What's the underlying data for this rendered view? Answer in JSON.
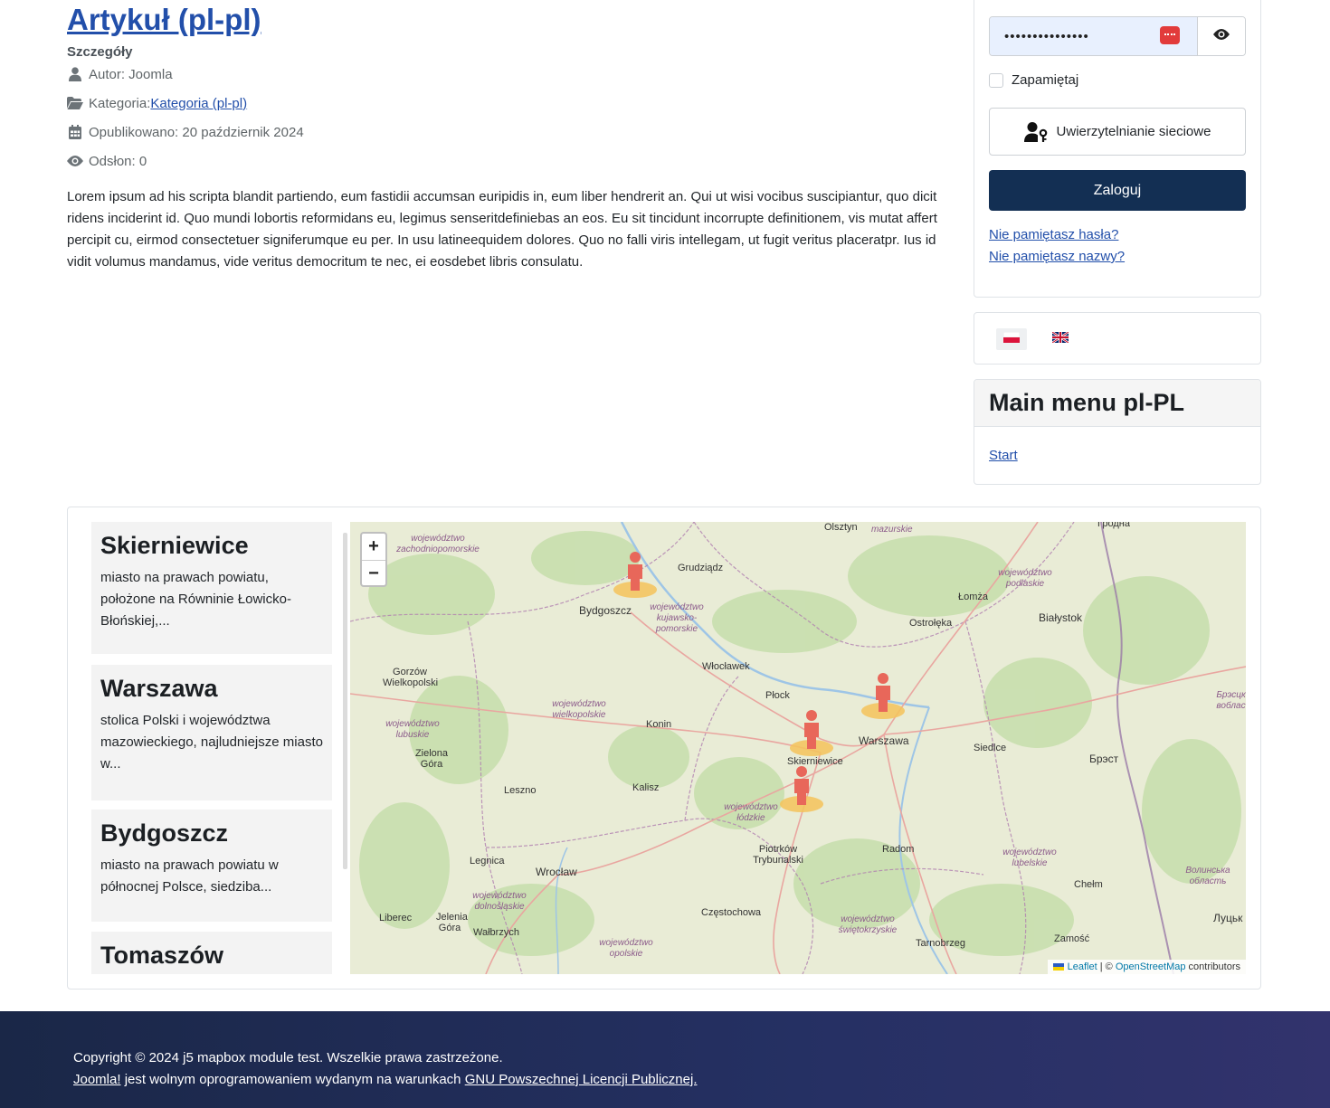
{
  "article": {
    "title": "Artykuł (pl-pl)",
    "details_heading": "Szczegóły",
    "author": "Autor: Joomla",
    "category_prefix": "Kategoria: ",
    "category_link": "Kategoria (pl-pl)",
    "published": "Opublikowano: 20 październik 2024",
    "hits": "Odsłon: 0",
    "body": "Lorem ipsum ad his scripta blandit partiendo, eum fastidii accumsan euripidis in, eum liber hendrerit an. Qui ut wisi vocibus suscipiantur, quo dicit ridens inciderint id. Quo mundi lobortis reformidans eu, legimus senseritdefiniebas an eos. Eu sit tincidunt incorrupte definitionem, vis mutat affert percipit cu, eirmod consectetuer signiferumque eu per. In usu latineequidem dolores. Quo no falli viris intellegam, ut fugit veritus placeratpr. Ius id vidit volumus mandamus, vide veritus democritum te nec, ei eosdebet libris consulatu."
  },
  "login": {
    "password_value": "•••••••••••••••",
    "remember_label": "Zapamiętaj",
    "webauthn_label": "Uwierzytelnianie sieciowe",
    "login_button": "Zaloguj",
    "forgot_password": "Nie pamiętasz hasła?",
    "forgot_username": "Nie pamiętasz nazwy?"
  },
  "languages": [
    "pl-PL",
    "en-GB"
  ],
  "main_menu": {
    "title": "Main menu pl-PL",
    "items": [
      "Start"
    ]
  },
  "places": [
    {
      "name": "Skierniewice",
      "desc": "miasto na prawach powiatu, położone na Równinie Łowicko-Błońskiej,..."
    },
    {
      "name": "Warszawa",
      "desc": "stolica Polski i województwa mazowieckiego, najludniejsze miasto w..."
    },
    {
      "name": "Bydgoszcz",
      "desc": "miasto na prawach powiatu w północnej Polsce, siedziba..."
    },
    {
      "name": "Tomaszów",
      "desc": ""
    }
  ],
  "map": {
    "zoom_in": "+",
    "zoom_out": "−",
    "attribution_leaflet": "Leaflet",
    "attribution_sep": " | © ",
    "attribution_osm": "OpenStreetMap",
    "attribution_tail": " contributors",
    "labels": {
      "olsztyn": "Olsztyn",
      "mazurskie": "mazurskie",
      "grodno": "Гродна",
      "zachodniopomorskie": "województwo zachodniopomorskie",
      "grudziadz": "Grudziądz",
      "podlaskie": "województwo podlaskie",
      "lomza": "Łomża",
      "bydgoszcz": "Bydgoszcz",
      "kujawsko": "województwo kujawsko-pomorskie",
      "ostroleka": "Ostrołęka",
      "bialystok": "Białystok",
      "gorzow": "Gorzów Wielkopolski",
      "wloclawek": "Włocławek",
      "wielkopolskie": "województwo wielkopolskie",
      "plock": "Płock",
      "brest_obl": "Брэсцкая вобласць",
      "lubuskie": "województwo lubuskie",
      "konin": "Konin",
      "warszawa": "Warszawa",
      "siedlce": "Siedlce",
      "zielona": "Zielona Góra",
      "skierniewice": "Skierniewice",
      "brest": "Брэст",
      "kalisz": "Kalisz",
      "leszno": "Leszno",
      "lodzkie": "województwo łódzkie",
      "radom": "Radom",
      "piotrkow": "Piotrków Trybunalski",
      "lubelskie": "województwo lubelskie",
      "legnica": "Legnica",
      "wroclaw": "Wrocław",
      "chelm": "Chełm",
      "volyn": "Волинська область",
      "dolnoslaskie": "województwo dolnośląskie",
      "jelenia": "Jelenia Góra",
      "czestochowa": "Częstochowa",
      "liberec": "Liberec",
      "walbrzych": "Wałbrzych",
      "swietokrzyskie": "województwo świętokrzyskie",
      "zamosc": "Zamość",
      "lutsk": "Луцьк",
      "opolskie": "województwo opolskie",
      "tarnobrzeg": "Tarnobrzeg"
    }
  },
  "footer": {
    "copyright": "Copyright © 2024 j5 mapbox module test. Wszelkie prawa zastrzeżone.",
    "joomla_link": "Joomla!",
    "middle_text": " jest wolnym oprogramowaniem wydanym na warunkach ",
    "license_link": "GNU Powszechnej Licencji Publicznej."
  },
  "colors": {
    "link": "#224faa",
    "login_button": "#132f53",
    "marker": "#e8675a",
    "marker_halo": "#f5c35a"
  }
}
